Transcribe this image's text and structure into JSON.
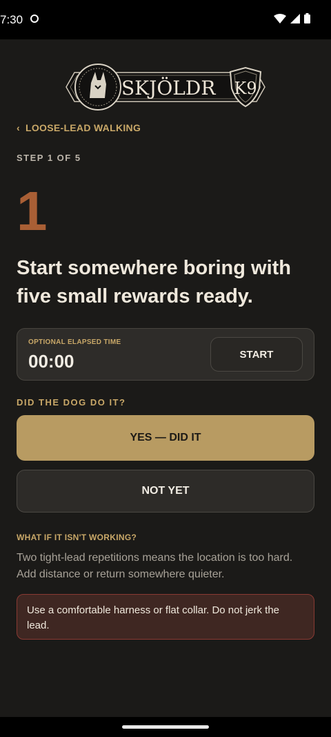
{
  "status_bar": {
    "time": "7:30"
  },
  "brand": {
    "name_main": "SKJÖLDR",
    "name_badge": "K9"
  },
  "nav": {
    "back_label": "LOOSE-LEAD WALKING"
  },
  "step": {
    "label": "STEP 1 OF 5",
    "number": "1",
    "headline": "Start somewhere boring with five small rewards ready."
  },
  "timer": {
    "label": "OPTIONAL ELAPSED TIME",
    "value": "00:00",
    "start_label": "START"
  },
  "check": {
    "question": "DID THE DOG DO IT?",
    "yes_label": "YES — DID IT",
    "no_label": "NOT YET"
  },
  "help": {
    "heading": "WHAT IF IT ISN'T WORKING?",
    "text": "Two tight-lead repetitions means the location is too hard. Add distance or return somewhere quieter."
  },
  "warning": {
    "text": "Use a comfortable harness or flat collar. Do not jerk the lead."
  },
  "colors": {
    "accent": "#c9a868",
    "step_number": "#a95f35",
    "yes_button": "#b89b62",
    "warning_border": "#8a3a33"
  }
}
